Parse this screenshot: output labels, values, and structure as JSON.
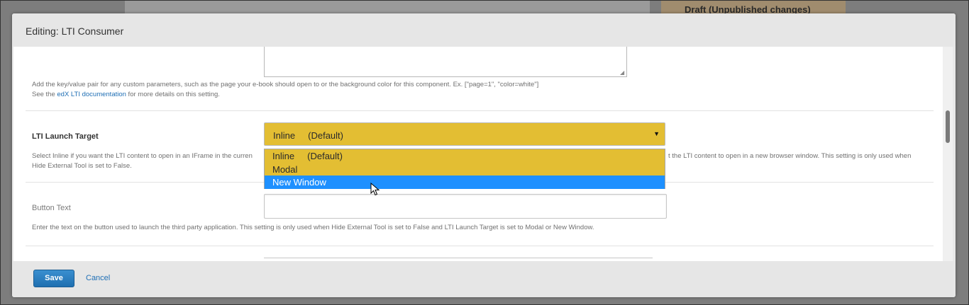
{
  "background": {
    "draft_status": "Draft (Unpublished changes)"
  },
  "modal": {
    "title": "Editing: LTI Consumer"
  },
  "custom_parameters": {
    "help_line1": "Add the key/value pair for any custom parameters, such as the page your e-book should open to or the background color for this component. Ex. [\"page=1\", \"color=white\"]",
    "help_see": "See the ",
    "help_link": "edX LTI documentation",
    "help_after": " for more details on this setting."
  },
  "launch_target": {
    "label": "LTI Launch Target",
    "selected_value": "Inline     (Default)",
    "help_left": "Select Inline if you want the LTI content to open in an IFrame in the curren",
    "help_right": "t the LTI content to open in a new browser window. This setting is only used when",
    "help_line2": "Hide External Tool is set to False.",
    "options": [
      {
        "label": "Inline     (Default)",
        "highlighted": false
      },
      {
        "label": "Modal",
        "highlighted": false
      },
      {
        "label": "New Window",
        "highlighted": true
      }
    ]
  },
  "button_text": {
    "label": "Button Text",
    "value": "",
    "help": "Enter the text on the button used to launch the third party application. This setting is only used when Hide External Tool is set to False and LTI Launch Target is set to Modal or New Window."
  },
  "footer": {
    "save_label": "Save",
    "cancel_label": "Cancel"
  },
  "colors": {
    "select_bg": "#e3be33",
    "highlight": "#1e90ff",
    "link": "#1f6fb5",
    "save_button": "#2a7fc0"
  },
  "icons": {
    "dropdown_arrow": "triangle-down-icon",
    "mouse_cursor": "arrow-cursor-icon"
  }
}
